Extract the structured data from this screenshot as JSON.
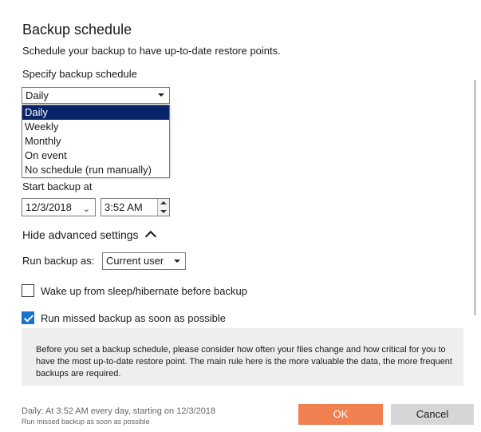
{
  "dialog": {
    "title": "Backup schedule",
    "subtitle": "Schedule your backup to have up-to-date restore points."
  },
  "schedule": {
    "label": "Specify backup schedule",
    "selected": "Daily",
    "options": [
      "Daily",
      "Weekly",
      "Monthly",
      "On event",
      "No schedule (run manually)"
    ]
  },
  "start": {
    "label": "Start backup at",
    "date": "12/3/2018",
    "time": "3:52 AM"
  },
  "advanced": {
    "toggle_label": "Hide advanced settings",
    "run_as_label": "Run backup as:",
    "run_as_value": "Current user",
    "wake_label": "Wake up from sleep/hibernate before backup",
    "wake_checked": false,
    "missed_label": "Run missed backup as soon as possible",
    "missed_checked": true
  },
  "info": {
    "text": "Before you set a backup schedule, please consider how often your files change and how critical for you to have the most up-to-date restore point. The main rule here is the more valuable the data, the more frequent backups are required."
  },
  "footer": {
    "summary_line1": "Daily: At 3:52 AM every day, starting on 12/3/2018",
    "summary_line2": "Run missed backup as soon as possible",
    "ok_label": "OK",
    "cancel_label": "Cancel"
  },
  "colors": {
    "ok_button": "#f08050",
    "cancel_button": "#d6d6d6",
    "selected_option": "#0a246a",
    "checkbox_checked": "#1a73c9"
  }
}
